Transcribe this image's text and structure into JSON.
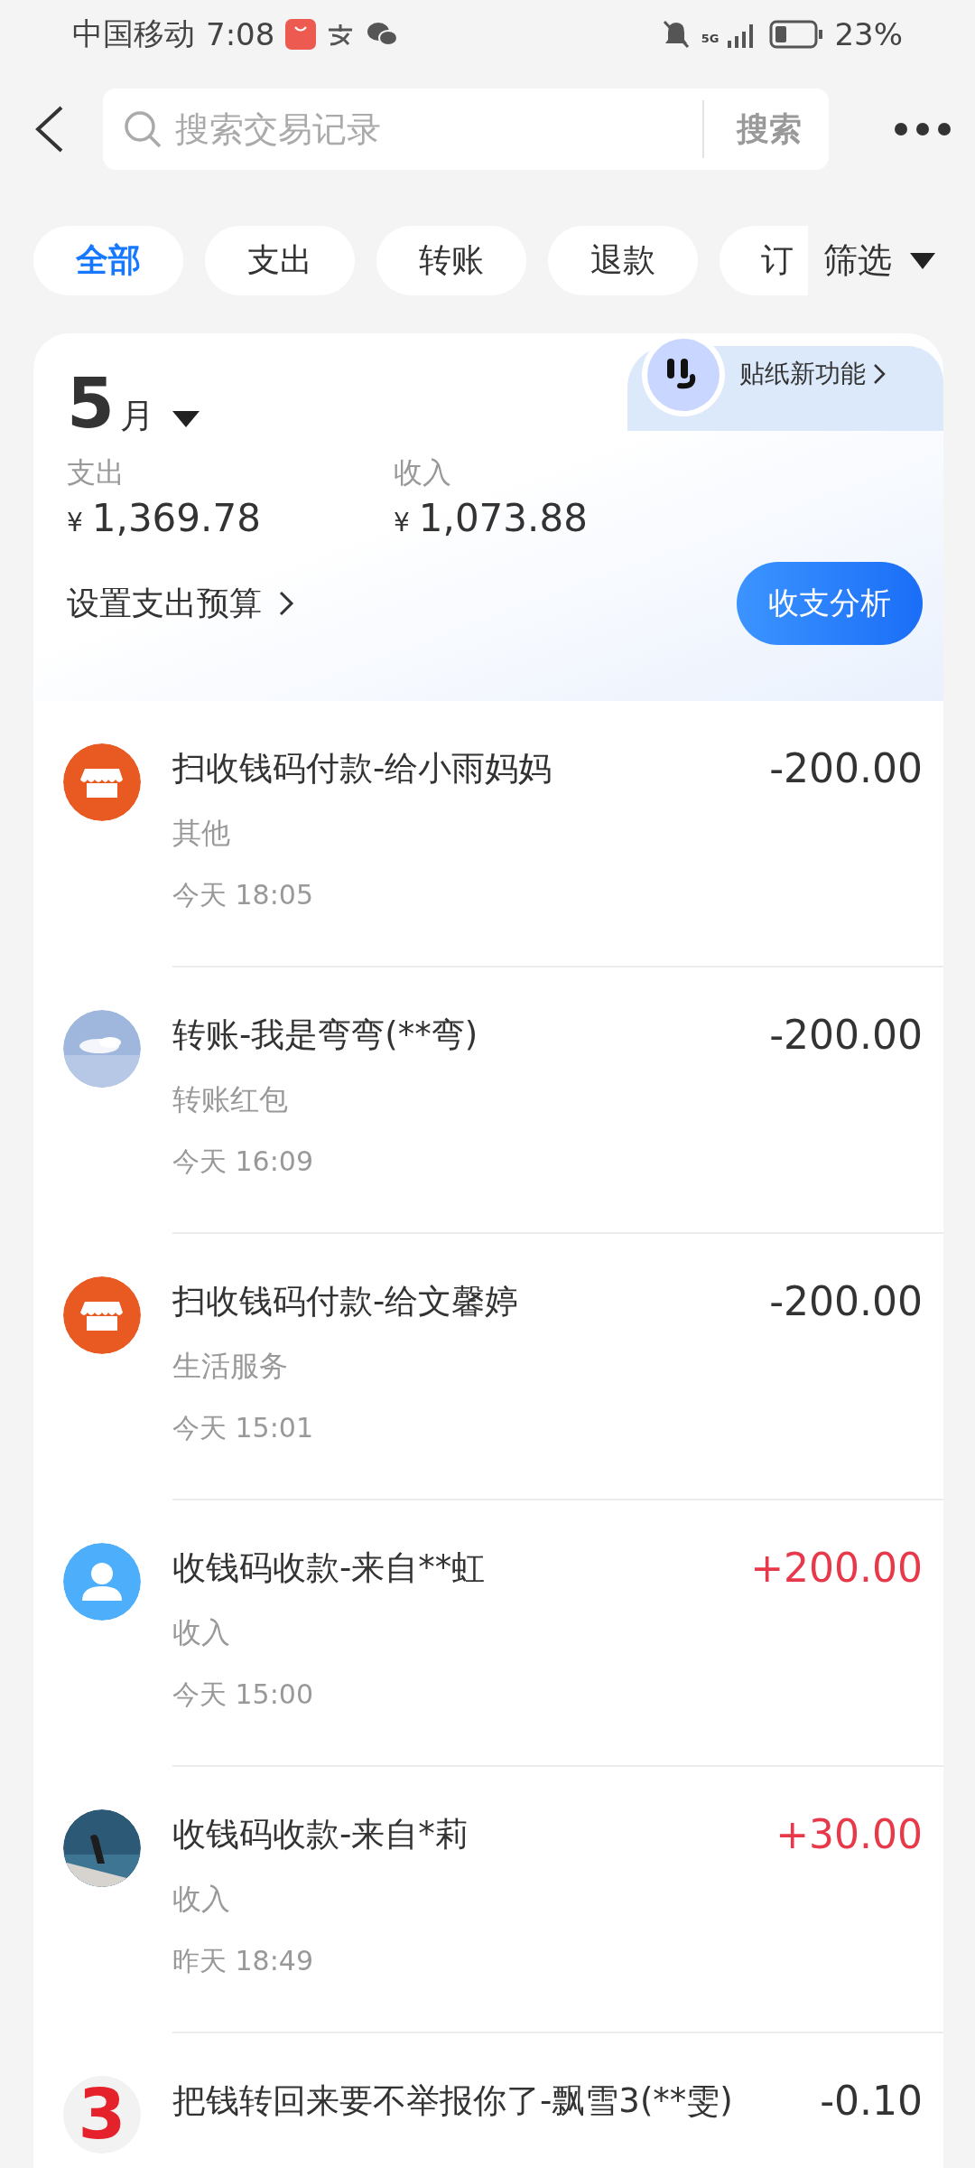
{
  "status_bar": {
    "carrier": "中国移动",
    "time": "7:08",
    "network": "5G",
    "battery": "23%"
  },
  "search": {
    "placeholder": "搜索交易记录",
    "button": "搜索"
  },
  "filters": [
    {
      "label": "全部",
      "selected": true
    },
    {
      "label": "支出",
      "selected": false
    },
    {
      "label": "转账",
      "selected": false
    },
    {
      "label": "退款",
      "selected": false
    },
    {
      "label": "订",
      "selected": false
    }
  ],
  "filter_button": "筛选",
  "summary": {
    "month": "5",
    "month_unit": "月",
    "expense_label": "支出",
    "expense_currency": "¥",
    "expense": "1,369.78",
    "income_label": "收入",
    "income_currency": "¥",
    "income": "1,073.88",
    "budget_link": "设置支出预算",
    "analysis_button": "收支分析",
    "sticker_promo": "贴纸新功能"
  },
  "transactions": [
    {
      "kind": "shop",
      "title": "扫收钱码付款-给小雨妈妈",
      "category": "其他",
      "time": "今天 18:05",
      "amount": "-200.00",
      "income": false
    },
    {
      "kind": "picture",
      "title": "转账-我是弯弯(**弯)",
      "category": "转账红包",
      "time": "今天 16:09",
      "amount": "-200.00",
      "income": false
    },
    {
      "kind": "shop",
      "title": "扫收钱码付款-给文馨婷",
      "category": "生活服务",
      "time": "今天 15:01",
      "amount": "-200.00",
      "income": false
    },
    {
      "kind": "person",
      "title": "收钱码收款-来自**虹",
      "category": "收入",
      "time": "今天 15:00",
      "amount": "+200.00",
      "income": true
    },
    {
      "kind": "picture",
      "title": "收钱码收款-来自*莉",
      "category": "收入",
      "time": "昨天 18:49",
      "amount": "+30.00",
      "income": true
    },
    {
      "kind": "number",
      "icon_text": "3",
      "title": "把钱转回来要不举报你了-飘雪3(**雯)",
      "amount": "-0.10",
      "income": false
    }
  ]
}
